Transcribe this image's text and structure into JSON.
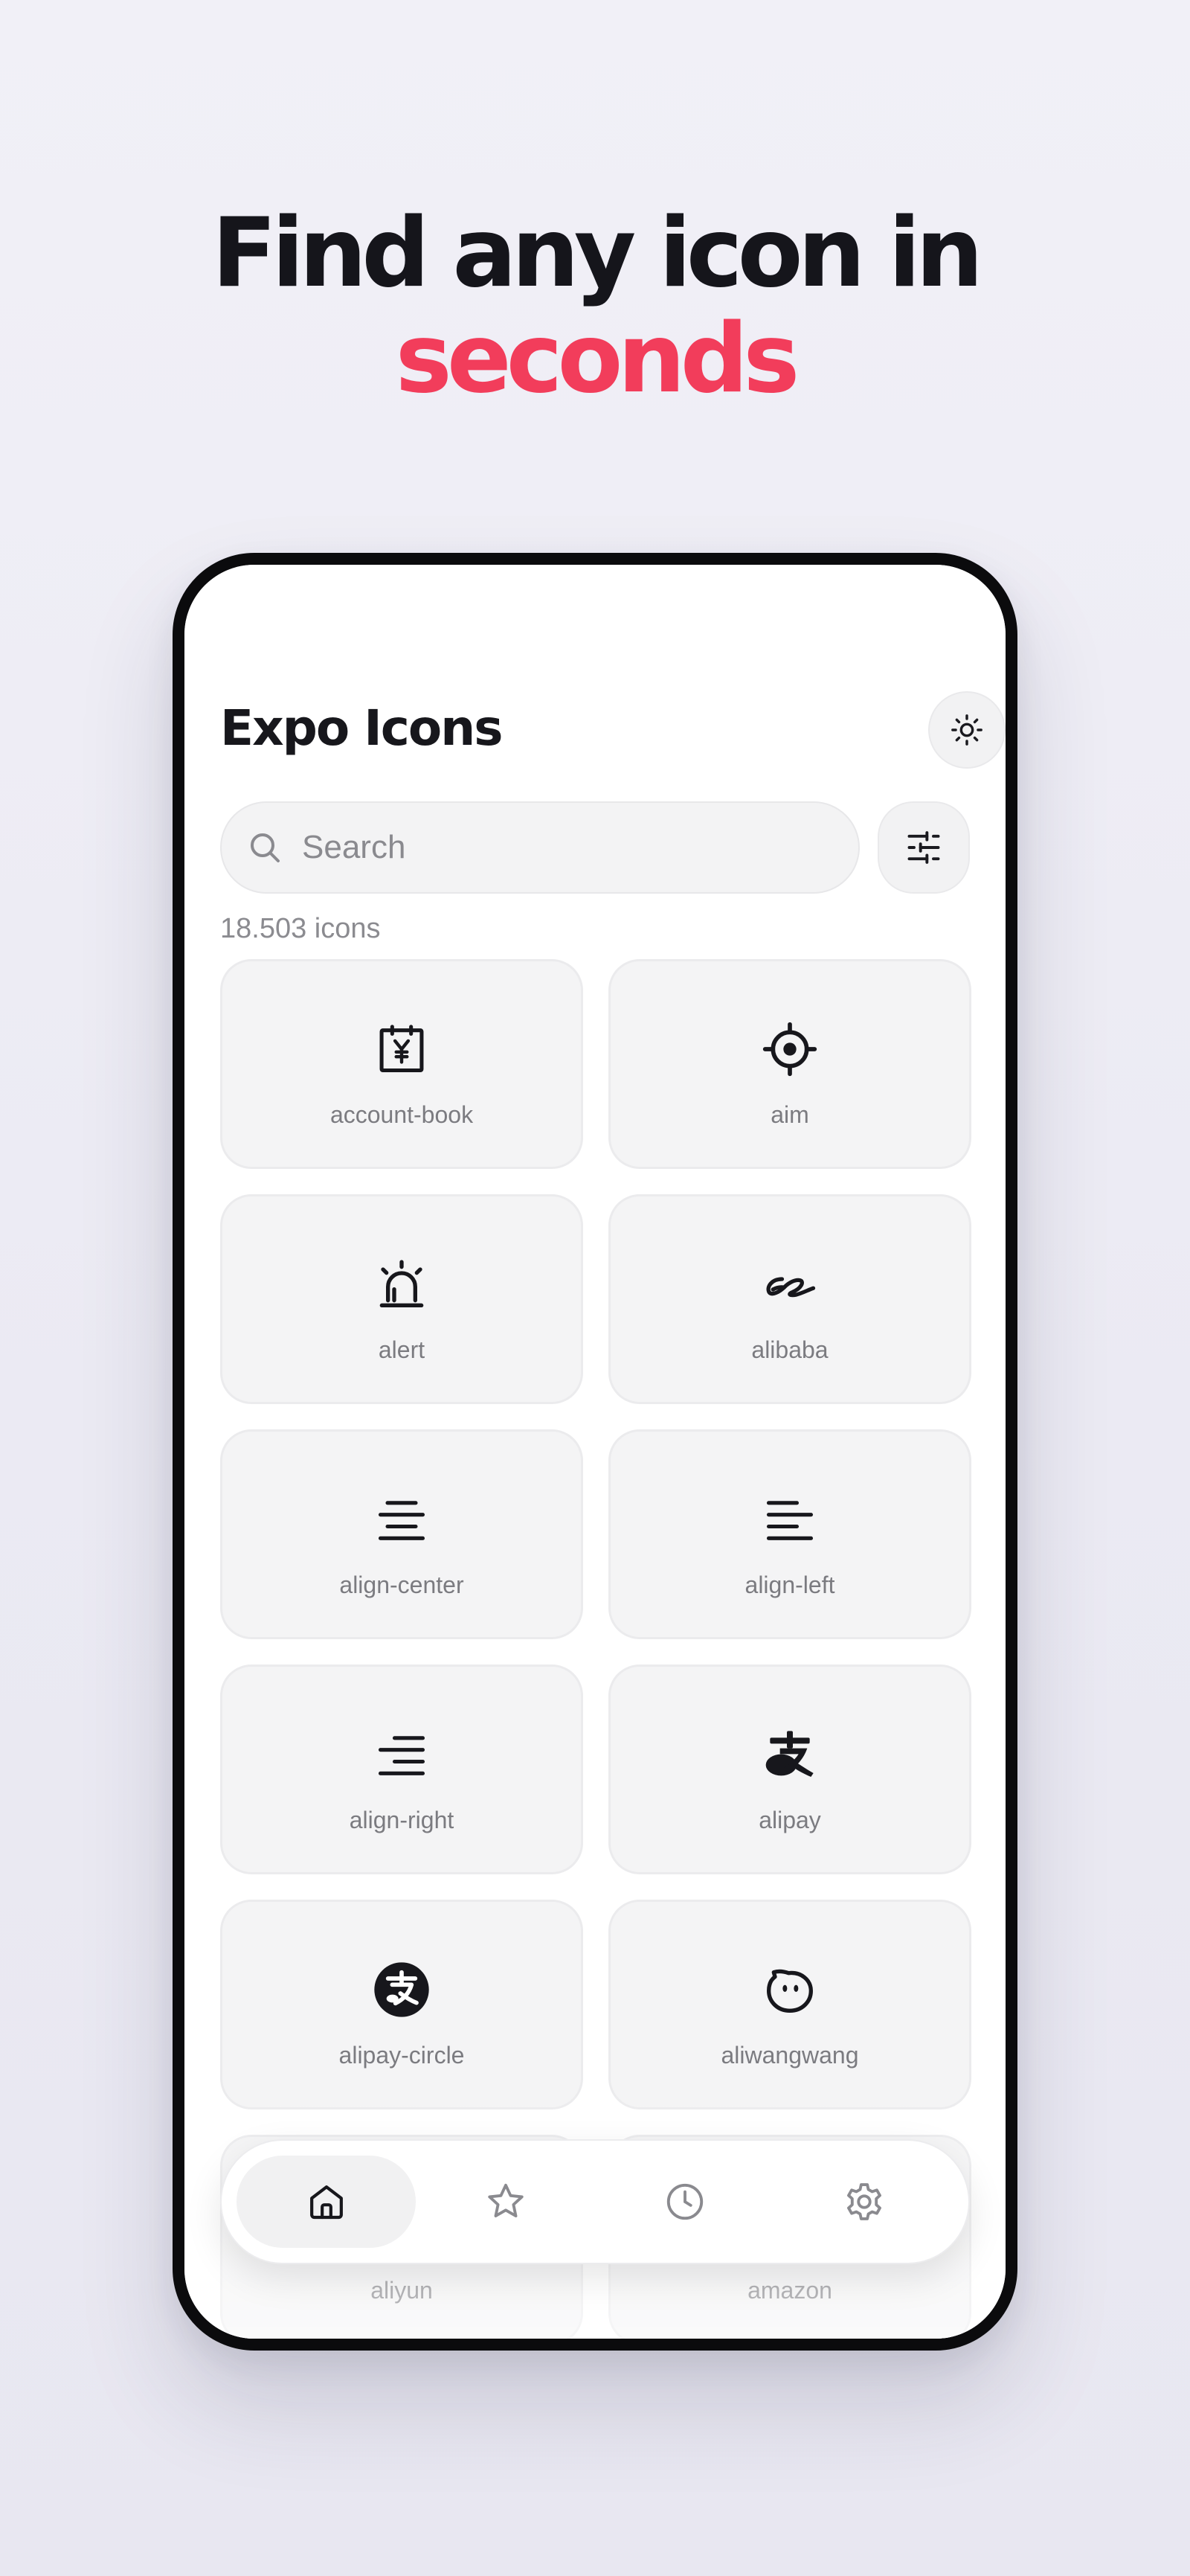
{
  "headline": {
    "line1": "Find any icon in",
    "line2": "seconds",
    "accent_color": "#f23d5b"
  },
  "app": {
    "title": "Expo Icons",
    "theme_toggle_icon": "sun-icon",
    "filter_icon": "sliders-icon"
  },
  "search": {
    "placeholder": "Search",
    "value": "",
    "icon": "search-icon"
  },
  "results": {
    "count_text": "18.503 icons"
  },
  "icons": [
    {
      "label": "account-book",
      "icon": "account-book-icon"
    },
    {
      "label": "aim",
      "icon": "aim-icon"
    },
    {
      "label": "alert",
      "icon": "alert-icon"
    },
    {
      "label": "alibaba",
      "icon": "alibaba-icon"
    },
    {
      "label": "align-center",
      "icon": "align-center-icon"
    },
    {
      "label": "align-left",
      "icon": "align-left-icon"
    },
    {
      "label": "align-right",
      "icon": "align-right-icon"
    },
    {
      "label": "alipay",
      "icon": "alipay-icon"
    },
    {
      "label": "alipay-circle",
      "icon": "alipay-circle-icon"
    },
    {
      "label": "aliwangwang",
      "icon": "aliwangwang-icon"
    },
    {
      "label": "aliyun",
      "icon": "aliyun-icon"
    },
    {
      "label": "amazon",
      "icon": "amazon-icon"
    }
  ],
  "tab_bar": {
    "tabs": [
      {
        "name": "home",
        "icon": "home-icon",
        "active": true
      },
      {
        "name": "favorites",
        "icon": "star-icon",
        "active": false
      },
      {
        "name": "history",
        "icon": "clock-icon",
        "active": false
      },
      {
        "name": "settings",
        "icon": "gear-icon",
        "active": false
      }
    ]
  }
}
